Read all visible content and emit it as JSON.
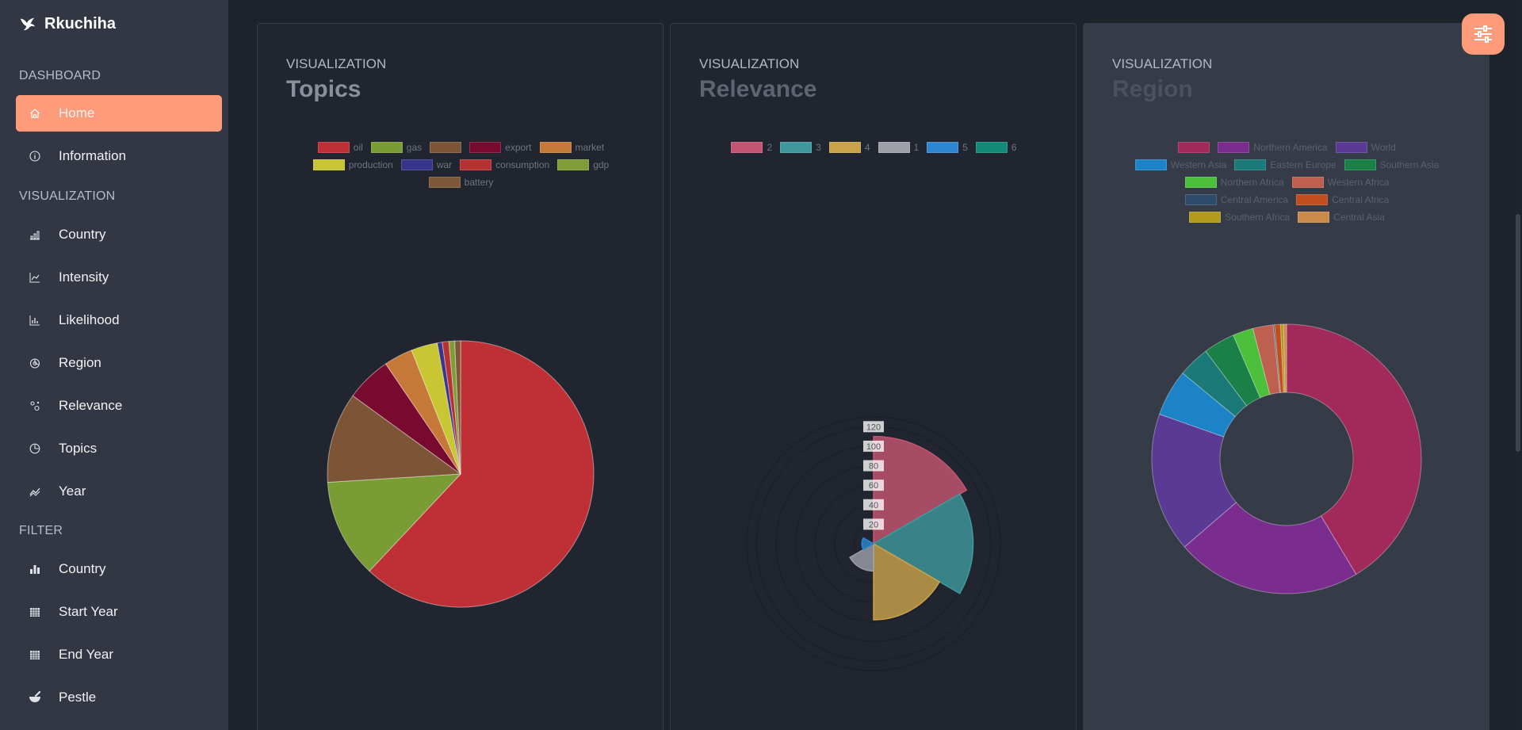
{
  "brand": {
    "name": "Rkuchiha",
    "icon": "bird-icon"
  },
  "sidebar": {
    "sections": [
      {
        "label": "DASHBOARD",
        "items": [
          {
            "label": "Home",
            "icon": "home-icon",
            "active": true
          },
          {
            "label": "Information",
            "icon": "info-icon"
          }
        ]
      },
      {
        "label": "VISUALIZATION",
        "items": [
          {
            "label": "Country",
            "icon": "bar-chart-icon"
          },
          {
            "label": "Intensity",
            "icon": "line-chart-icon"
          },
          {
            "label": "Likelihood",
            "icon": "column-chart-icon"
          },
          {
            "label": "Region",
            "icon": "pie-chart-icon"
          },
          {
            "label": "Relevance",
            "icon": "scatter-icon"
          },
          {
            "label": "Topics",
            "icon": "clock-pie-icon"
          },
          {
            "label": "Year",
            "icon": "trend-icon"
          }
        ]
      },
      {
        "label": "FILTER",
        "items": [
          {
            "label": "Country",
            "icon": "filled-bars-icon"
          },
          {
            "label": "Start Year",
            "icon": "calendar-grid-icon"
          },
          {
            "label": "End Year",
            "icon": "calendar-grid-icon"
          },
          {
            "label": "Pestle",
            "icon": "mortar-pestle-icon"
          }
        ]
      }
    ]
  },
  "cards": [
    {
      "kicker": "VISUALIZATION",
      "title": "Topics"
    },
    {
      "kicker": "VISUALIZATION",
      "title": "Relevance"
    },
    {
      "kicker": "VISUALIZATION",
      "title": "Region"
    }
  ],
  "settings_button": {
    "icon": "sliders-icon"
  },
  "colors": {
    "accent": "#fe9b7b",
    "sidebar": "#323743",
    "background": "#1e222b"
  },
  "chart_data": [
    {
      "type": "pie",
      "title": "Topics",
      "legend_placement": "top",
      "categories": [
        "oil",
        "gas",
        "",
        "export",
        "market",
        "production",
        "war",
        "consumption",
        "gdp",
        "battery"
      ],
      "values": [
        62,
        12,
        11,
        5.5,
        3.5,
        3.2,
        0.6,
        0.8,
        0.7,
        0.7
      ],
      "colors": [
        "#be3036",
        "#7a9c34",
        "#7c5536",
        "#780a30",
        "#c57837",
        "#c8c632",
        "#38358a",
        "#b63232",
        "#7f9c37",
        "#7d5838"
      ]
    },
    {
      "type": "polarArea",
      "title": "Relevance",
      "legend_placement": "top",
      "categories": [
        "2",
        "3",
        "4",
        "1",
        "5",
        "6"
      ],
      "values": [
        110,
        102,
        78,
        28,
        12,
        0
      ],
      "colors": [
        "#c45572",
        "#3f999c",
        "#c9a24a",
        "#9c9fa6",
        "#2e86d1",
        "#118a7a"
      ],
      "r_ticks": [
        "120",
        "100",
        "80",
        "60",
        "40",
        "20"
      ],
      "r_max": 130
    },
    {
      "type": "doughnut",
      "title": "Region",
      "legend_placement": "top",
      "categories": [
        "",
        "Northern America",
        "World",
        "Western Asia",
        "Eastern Europe",
        "Southern Asia",
        "Northern Africa",
        "Western Africa",
        "Central America",
        "Central Africa",
        "Southern Africa",
        "Central Asia"
      ],
      "values": [
        40.6,
        21.9,
        16.4,
        5.5,
        3.7,
        3.7,
        2.4,
        2.4,
        0.15,
        0.7,
        0.35,
        0.35
      ],
      "colors": [
        "#a12a5a",
        "#7b2d8f",
        "#5a3a94",
        "#1c84c6",
        "#1b7a77",
        "#1a8048",
        "#4cbf3d",
        "#bd6050",
        "#2e4c6a",
        "#c04e1e",
        "#b39a1d",
        "#c98a4a"
      ]
    }
  ]
}
